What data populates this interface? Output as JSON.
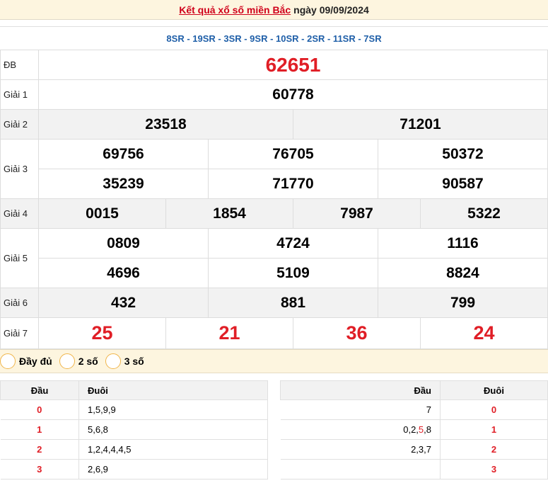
{
  "header": {
    "title": "Kết quả xổ số miền Bắc",
    "date": "ngày 09/09/2024"
  },
  "codes": "8SR - 19SR - 3SR - 9SR - 10SR - 2SR - 11SR - 7SR",
  "prizes": {
    "db": {
      "label": "ĐB",
      "values": [
        "62651"
      ]
    },
    "g1": {
      "label": "Giải 1",
      "values": [
        "60778"
      ]
    },
    "g2": {
      "label": "Giải 2",
      "values": [
        "23518",
        "71201"
      ]
    },
    "g3": {
      "label": "Giải 3",
      "values": [
        "69756",
        "76705",
        "50372",
        "35239",
        "71770",
        "90587"
      ]
    },
    "g4": {
      "label": "Giải 4",
      "values": [
        "0015",
        "1854",
        "7987",
        "5322"
      ]
    },
    "g5": {
      "label": "Giải 5",
      "values": [
        "0809",
        "4724",
        "1116",
        "4696",
        "5109",
        "8824"
      ]
    },
    "g6": {
      "label": "Giải 6",
      "values": [
        "432",
        "881",
        "799"
      ]
    },
    "g7": {
      "label": "Giải 7",
      "values": [
        "25",
        "21",
        "36",
        "24"
      ]
    }
  },
  "options": [
    "Đầy đủ",
    "2 số",
    "3 số"
  ],
  "dau_table": {
    "headers": [
      "Đầu",
      "Đuôi"
    ],
    "rows": [
      {
        "k": "0",
        "v": "1,5,9,9"
      },
      {
        "k": "1",
        "v": "5,6,8"
      },
      {
        "k": "2",
        "v": "1,2,4,4,4,5"
      },
      {
        "k": "3",
        "v": "2,6,9"
      }
    ]
  },
  "duoi_table": {
    "headers": [
      "Đầu",
      "Đuôi"
    ],
    "rows": [
      {
        "v_pre": "7",
        "v_hl": "",
        "v_post": "",
        "k": "0"
      },
      {
        "v_pre": "0,2,",
        "v_hl": "5",
        "v_post": ",8",
        "k": "1"
      },
      {
        "v_pre": "2,3,7",
        "v_hl": "",
        "v_post": "",
        "k": "2"
      },
      {
        "v_pre": "",
        "v_hl": "",
        "v_post": "",
        "k": "3"
      }
    ]
  }
}
